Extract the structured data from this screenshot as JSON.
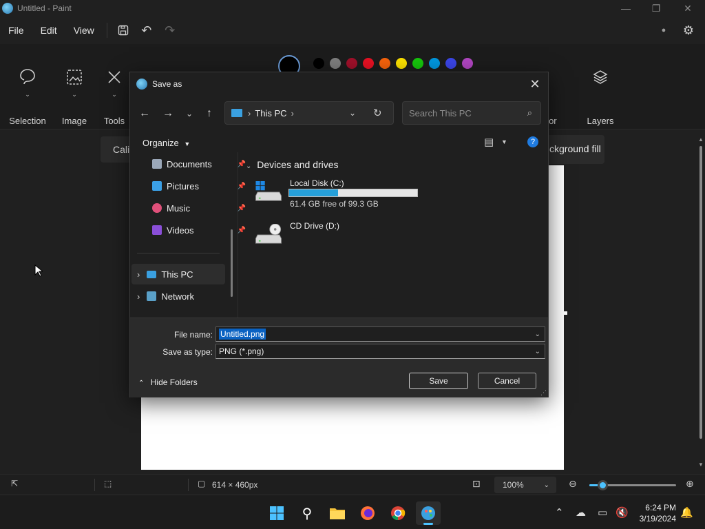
{
  "window": {
    "title": "Untitled - Paint"
  },
  "menu": {
    "file": "File",
    "edit": "Edit",
    "view": "View"
  },
  "ribbon": {
    "selection": "Selection",
    "image": "Image",
    "tools": "Tools",
    "creator": "eator",
    "layers": "Layers",
    "font_pill": "Cali",
    "bgfill": "ckground fill",
    "palette": [
      "#000000",
      "#7f7f7f",
      "#a0102a",
      "#e81123",
      "#f7630c",
      "#fce100",
      "#16c60c",
      "#0098e0",
      "#3b46e8",
      "#b146c2"
    ]
  },
  "status": {
    "canvas_size": "614 × 460px",
    "zoom": "100%",
    "zoom_fraction": 0.15
  },
  "taskbar": {
    "time": "6:24 PM",
    "date": "3/19/2024"
  },
  "dialog": {
    "title": "Save as",
    "address": {
      "location": "This PC"
    },
    "search_placeholder": "Search This PC",
    "organize": "Organize",
    "nav": {
      "documents": "Documents",
      "pictures": "Pictures",
      "music": "Music",
      "videos": "Videos",
      "this_pc": "This PC",
      "network": "Network"
    },
    "group": "Devices and drives",
    "drives": {
      "c": {
        "name": "Local Disk (C:)",
        "free": "61.4 GB free of 99.3 GB",
        "used_fraction": 0.38
      },
      "d": {
        "name": "CD Drive (D:)"
      }
    },
    "file_name_label": "File name:",
    "file_name": "Untitled.png",
    "save_type_label": "Save as type:",
    "save_type": "PNG (*.png)",
    "hide_folders": "Hide Folders",
    "save": "Save",
    "cancel": "Cancel"
  }
}
